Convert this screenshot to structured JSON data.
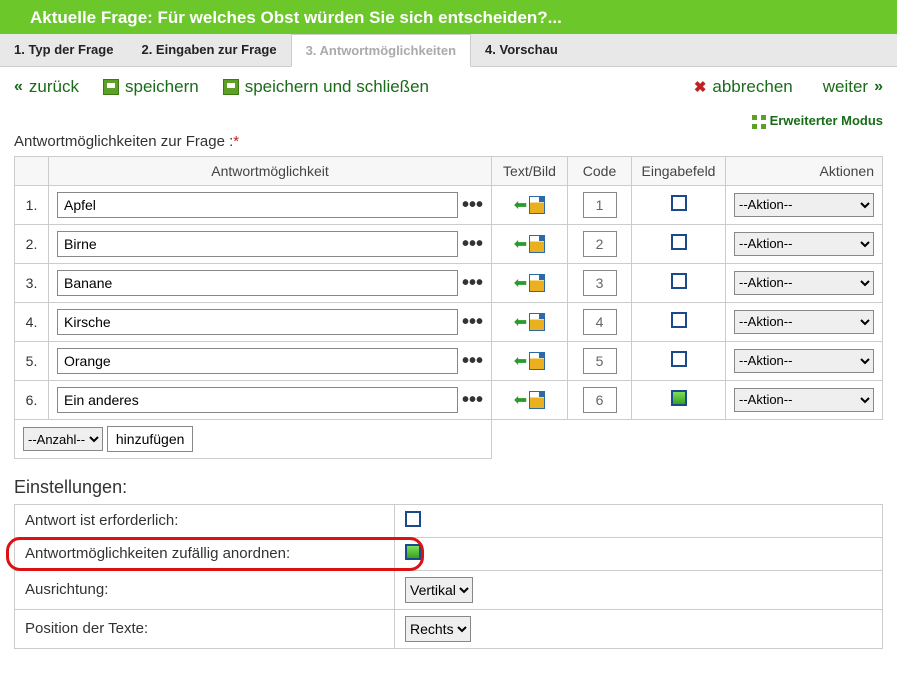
{
  "header": {
    "title": "Aktuelle Frage: Für welches Obst würden Sie sich entscheiden?..."
  },
  "tabs": [
    {
      "label": "1. Typ der Frage",
      "active": false
    },
    {
      "label": "2. Eingaben zur Frage",
      "active": false
    },
    {
      "label": "3. Antwortmöglichkeiten",
      "active": true
    },
    {
      "label": "4. Vorschau",
      "active": false
    }
  ],
  "toolbar": {
    "back": "zurück",
    "save": "speichern",
    "save_close": "speichern und schließen",
    "cancel": "abbrechen",
    "next": "weiter"
  },
  "extended_mode": "Erweiterter Modus",
  "section_label": "Antwortmöglichkeiten zur Frage :",
  "table": {
    "headers": {
      "answer": "Antwortmöglichkeit",
      "text_image": "Text/Bild",
      "code": "Code",
      "input_field": "Eingabefeld",
      "actions": "Aktionen"
    },
    "action_placeholder": "--Aktion--",
    "rows": [
      {
        "idx": "1.",
        "value": "Apfel",
        "code": "1",
        "input_on": false
      },
      {
        "idx": "2.",
        "value": "Birne",
        "code": "2",
        "input_on": false
      },
      {
        "idx": "3.",
        "value": "Banane",
        "code": "3",
        "input_on": false
      },
      {
        "idx": "4.",
        "value": "Kirsche",
        "code": "4",
        "input_on": false
      },
      {
        "idx": "5.",
        "value": "Orange",
        "code": "5",
        "input_on": false
      },
      {
        "idx": "6.",
        "value": "Ein anderes",
        "code": "6",
        "input_on": true
      }
    ],
    "add": {
      "count_placeholder": "--Anzahl--",
      "button": "hinzufügen"
    }
  },
  "settings": {
    "title": "Einstellungen:",
    "rows": {
      "required": {
        "label": "Antwort ist erforderlich:",
        "on": false
      },
      "randomize": {
        "label": "Antwortmöglichkeiten zufällig anordnen:",
        "on": true
      },
      "orientation": {
        "label": "Ausrichtung:",
        "value": "Vertikal"
      },
      "text_position": {
        "label": "Position der Texte:",
        "value": "Rechts"
      }
    }
  }
}
